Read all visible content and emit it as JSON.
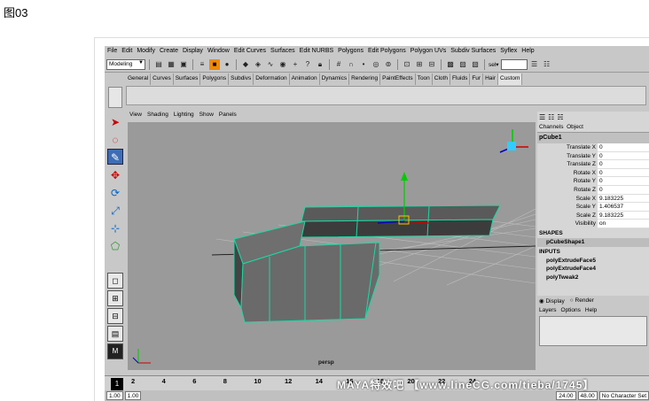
{
  "caption": "图03",
  "menu": [
    "File",
    "Edit",
    "Modify",
    "Create",
    "Display",
    "Window",
    "Edit Curves",
    "Surfaces",
    "Edit NURBS",
    "Polygons",
    "Edit Polygons",
    "Polygon UVs",
    "Subdiv Surfaces",
    "Syflex",
    "Help"
  ],
  "status": {
    "mode": "Modeling",
    "sel_label": "sel▾"
  },
  "shelf_tabs": [
    "General",
    "Curves",
    "Surfaces",
    "Polygons",
    "Subdivs",
    "Deformation",
    "Animation",
    "Dynamics",
    "Rendering",
    "PaintEffects",
    "Toon",
    "Cloth",
    "Fluids",
    "Fur",
    "Hair",
    "Custom"
  ],
  "shelf_active": "Custom",
  "panel_menu": [
    "View",
    "Shading",
    "Lighting",
    "Show",
    "Panels"
  ],
  "viewport_label": "persp",
  "channel_tabs": [
    "Channels",
    "Object"
  ],
  "object_name": "pCube1",
  "attributes": [
    {
      "name": "Translate X",
      "value": "0"
    },
    {
      "name": "Translate Y",
      "value": "0"
    },
    {
      "name": "Translate Z",
      "value": "0"
    },
    {
      "name": "Rotate X",
      "value": "0"
    },
    {
      "name": "Rotate Y",
      "value": "0"
    },
    {
      "name": "Rotate Z",
      "value": "0"
    },
    {
      "name": "Scale X",
      "value": "9.183225"
    },
    {
      "name": "Scale Y",
      "value": "1.406537"
    },
    {
      "name": "Scale Z",
      "value": "9.183225"
    },
    {
      "name": "Visibility",
      "value": "on"
    }
  ],
  "shapes_header": "SHAPES",
  "shape": "pCubeShape1",
  "inputs_header": "INPUTS",
  "inputs": [
    "polyExtrudeFace5",
    "polyExtrudeFace4",
    "polyTweak2"
  ],
  "layer_radios": [
    "Display",
    "Render"
  ],
  "layer_menu": [
    "Layers",
    "Options",
    "Help"
  ],
  "time": {
    "current": "1",
    "ticks": [
      "2",
      "4",
      "6",
      "8",
      "10",
      "12",
      "14",
      "16",
      "18",
      "20",
      "22",
      "24"
    ],
    "range_start": "1.00",
    "range_start2": "1.00",
    "range_end": "24.00",
    "range_end2": "48.00",
    "char_set": "No Character Set"
  },
  "watermark": "MAYA特效吧 【www.lineCG.com/tieba/1745】"
}
